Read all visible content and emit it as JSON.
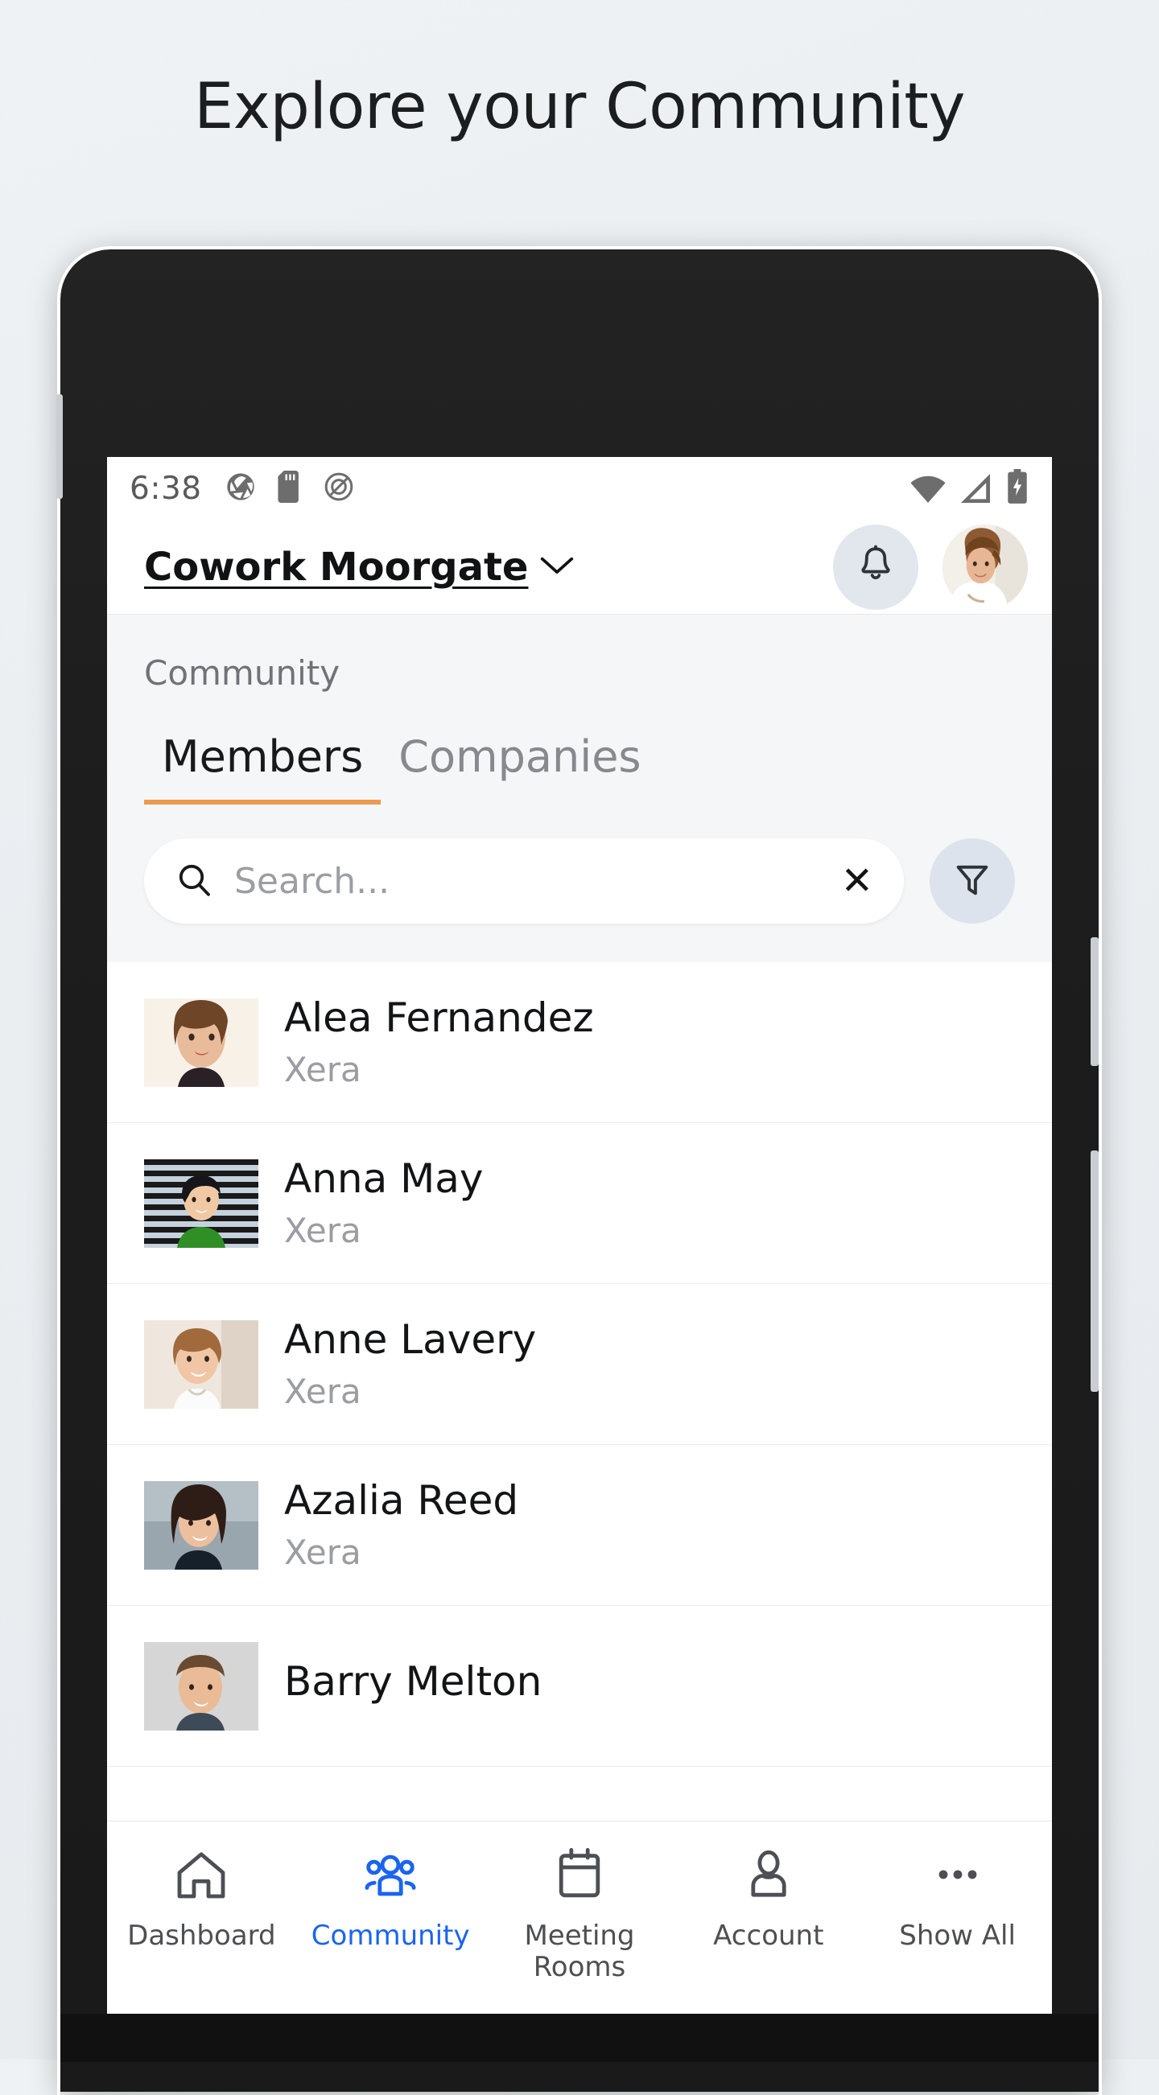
{
  "hero": {
    "title": "Explore your Community"
  },
  "status_bar": {
    "time": "6:38",
    "left_icons": [
      "shutter-app-icon",
      "sd-card-icon",
      "target-app-icon"
    ],
    "right_icons": [
      "wifi-icon",
      "cell-signal-icon",
      "battery-charging-icon"
    ]
  },
  "app_bar": {
    "venue_name": "Cowork Moorgate",
    "venue_chevron": "chevron-down-icon",
    "notifications": "bell-icon",
    "avatar": "user-avatar"
  },
  "section": {
    "label": "Community",
    "tabs": [
      {
        "label": "Members",
        "active": true
      },
      {
        "label": "Companies",
        "active": false
      }
    ],
    "accent_color": "#eb9b4e"
  },
  "search": {
    "placeholder": "Search...",
    "value": "",
    "clear_label": "✕",
    "filter_icon": "filter-funnel-icon"
  },
  "members": [
    {
      "name": "Alea Fernandez",
      "company": "Xera"
    },
    {
      "name": "Anna May",
      "company": "Xera"
    },
    {
      "name": "Anne Lavery",
      "company": "Xera"
    },
    {
      "name": "Azalia Reed",
      "company": "Xera"
    },
    {
      "name": "Barry Melton",
      "company": ""
    }
  ],
  "bottom_nav": {
    "active_color": "#1a64f0",
    "items": [
      {
        "label": "Dashboard",
        "icon": "home-icon",
        "active": false
      },
      {
        "label": "Community",
        "icon": "people-group-icon",
        "active": true
      },
      {
        "label": "Meeting\nRooms",
        "icon": "calendar-icon",
        "active": false
      },
      {
        "label": "Account",
        "icon": "person-icon",
        "active": false
      },
      {
        "label": "Show All",
        "icon": "ellipsis-icon",
        "active": false
      }
    ]
  }
}
